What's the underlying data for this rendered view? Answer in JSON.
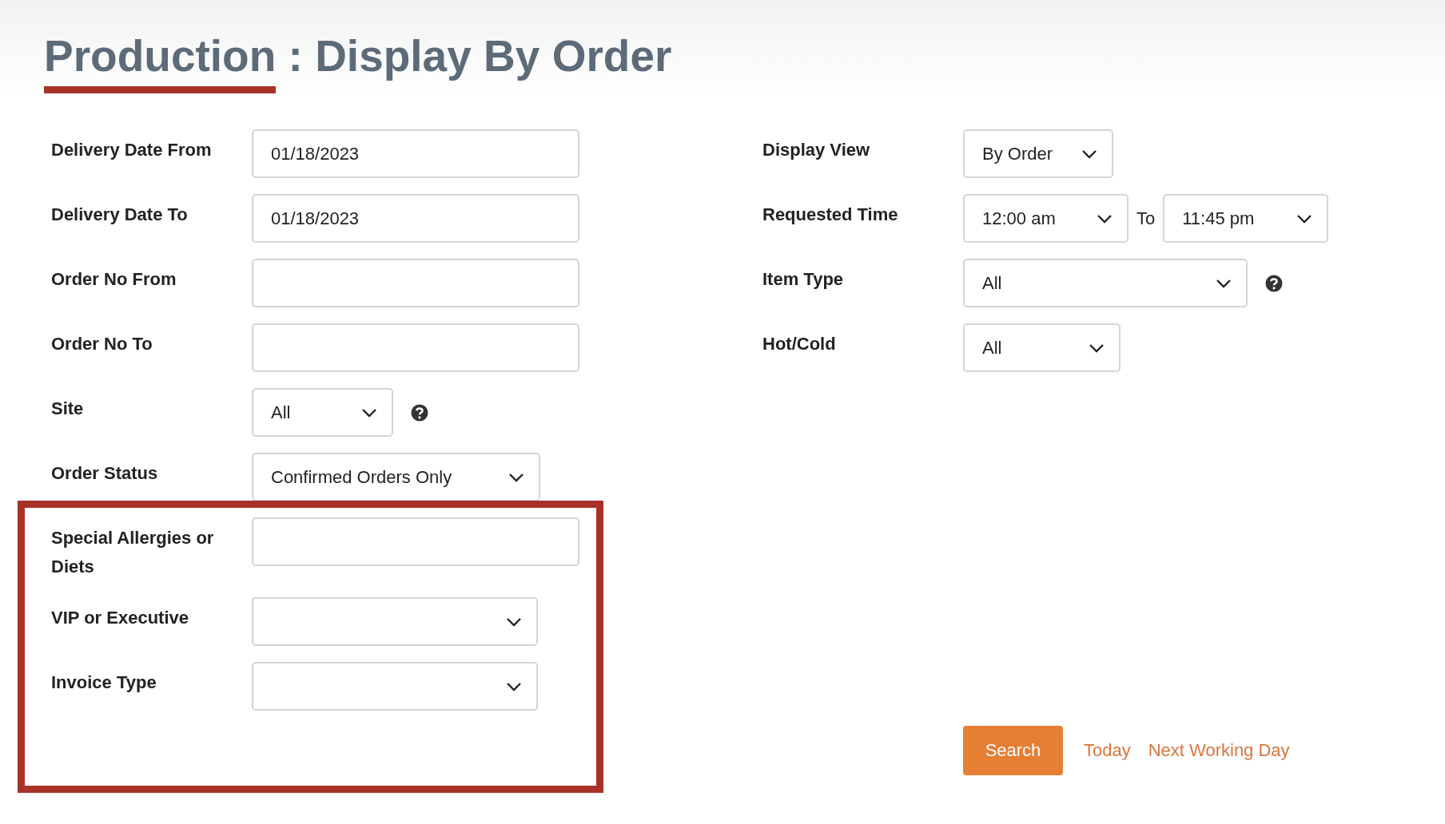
{
  "title": {
    "highlight": "Production",
    "rest": ": Display By Order"
  },
  "left_fields": [
    {
      "label": "Delivery Date From",
      "kind": "text",
      "value": "01/18/2023",
      "help": false
    },
    {
      "label": "Delivery Date To",
      "kind": "text",
      "value": "01/18/2023",
      "help": false
    },
    {
      "label": "Order No From",
      "kind": "text",
      "help": false
    },
    {
      "label": "Order No To",
      "kind": "text",
      "help": false
    },
    {
      "label": "Site",
      "kind": "select",
      "value": "All",
      "help": true
    },
    {
      "label": "Order Status",
      "kind": "select",
      "value": "Confirmed Orders Only",
      "help": false
    }
  ],
  "highlighted_fields": [
    {
      "label": "Special Allergies or Diets",
      "kind": "text",
      "help": false
    },
    {
      "label": "VIP or Executive",
      "kind": "select",
      "help": false
    },
    {
      "label": "Invoice Type",
      "kind": "select",
      "help": false
    }
  ],
  "right_fields": [
    {
      "label": "Display View",
      "kind": "select",
      "value": "By Order",
      "help": false
    },
    {
      "label": "Requested Time",
      "kind": "range",
      "value": "12:00 am",
      "separator": "To",
      "value_to": "11:45 pm",
      "help": false
    },
    {
      "label": "Item Type",
      "kind": "select",
      "value": "All",
      "help": true
    },
    {
      "label": "Hot/Cold",
      "kind": "select",
      "value": "All",
      "help": false
    }
  ],
  "actions": {
    "button": "Search",
    "links": [
      "Today",
      "Next Working Day"
    ]
  }
}
